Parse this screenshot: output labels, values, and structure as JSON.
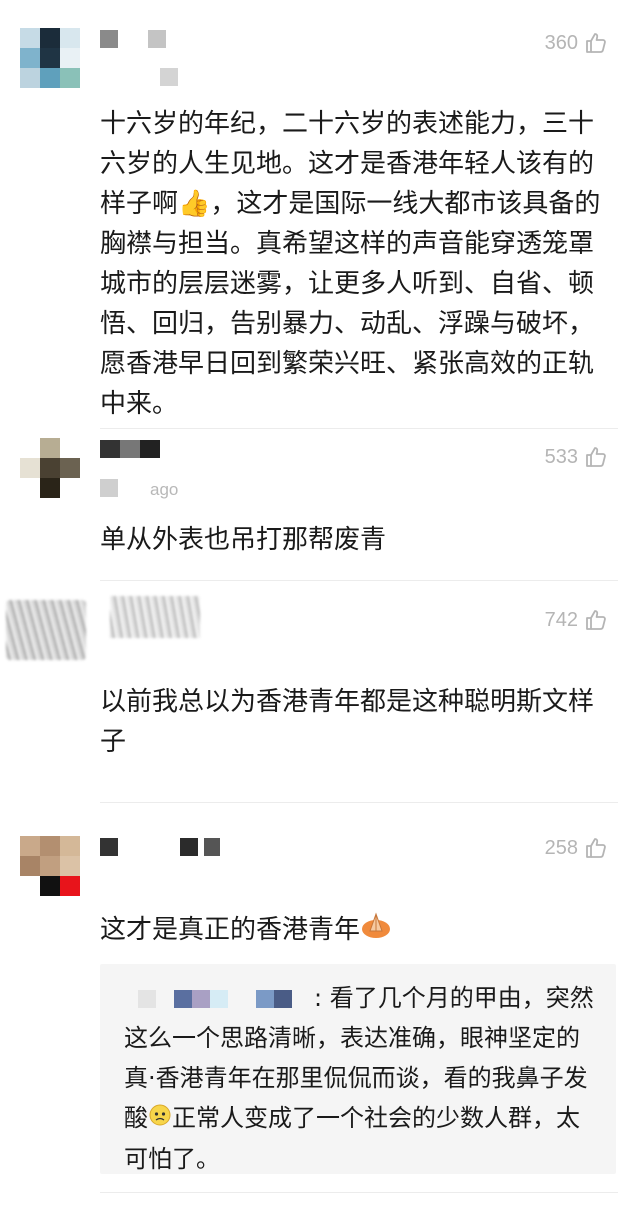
{
  "comments": [
    {
      "likes": "360",
      "meta": "",
      "text": "十六岁的年纪，二十六岁的表述能力，三十六岁的人生见地。这才是香港年轻人该有的样子啊👍，这才是国际一线大都市该具备的胸襟与担当。真希望这样的声音能穿透笼罩城市的层层迷雾，让更多人听到、自省、顿悟、回归，告别暴力、动乱、浮躁与破坏，愿香港早日回到繁荣兴旺、紧张高效的正轨中来。"
    },
    {
      "likes": "533",
      "meta": "ago",
      "text": "单从外表也吊打那帮废青"
    },
    {
      "likes": "742",
      "meta": "",
      "text": "以前我总以为香港青年都是这种聪明斯文样子"
    },
    {
      "likes": "258",
      "meta": "",
      "text": "这才是真正的香港青年",
      "reply": {
        "text": ": 看了几个月的甲由，突然这么一个思路清晰，表达准确，眼神坚定的真·香港青年在那里侃侃而谈，看的我鼻子发酸",
        "text_after": "正常人变成了一个社会的少数人群，太可怕了。"
      }
    }
  ],
  "colors": {
    "muted": "#b5b5b5",
    "text": "#1a1a1a",
    "reply_bg": "#f5f5f5"
  },
  "icons": {
    "like": "thumbs-up-outline-icon"
  }
}
